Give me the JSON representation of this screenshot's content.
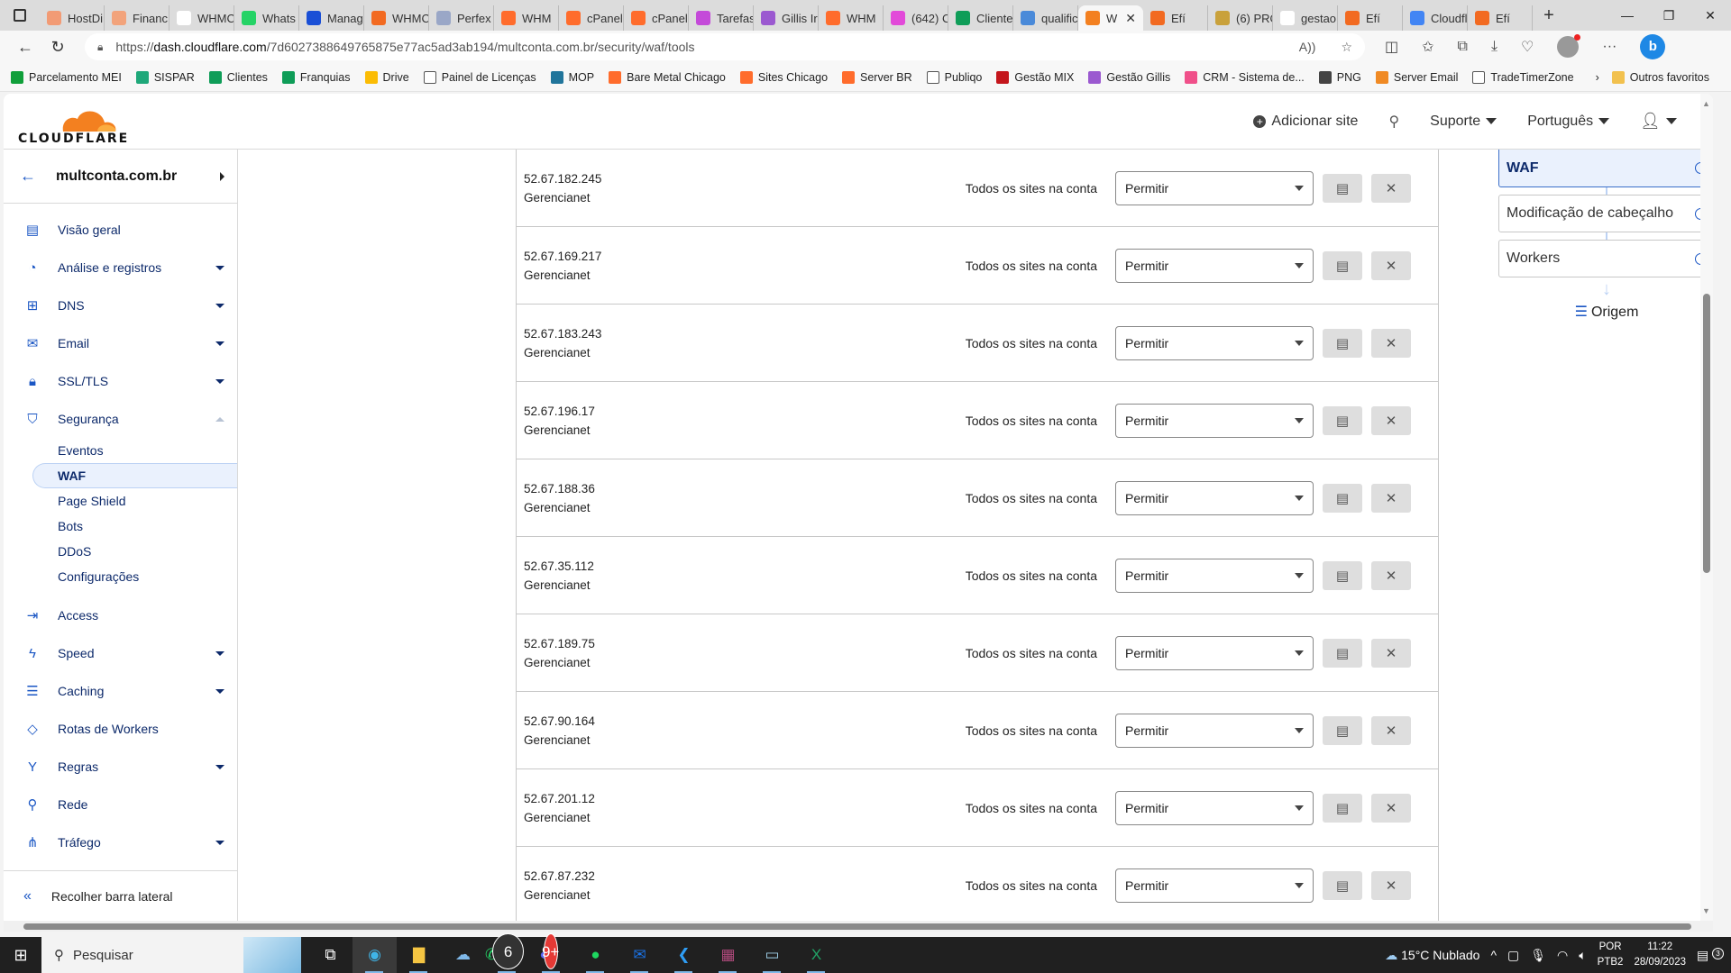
{
  "browser": {
    "tabs": [
      {
        "label": "HostDi",
        "color": "#f29b75"
      },
      {
        "label": "Financ",
        "color": "#f2a37b"
      },
      {
        "label": "WHMC",
        "color": "#ffffff"
      },
      {
        "label": "Whats",
        "color": "#25d366"
      },
      {
        "label": "Manag",
        "color": "#1a4fd6"
      },
      {
        "label": "WHMC",
        "color": "#f26a21"
      },
      {
        "label": "Perfex",
        "color": "#9aa7c7"
      },
      {
        "label": "WHM",
        "color": "#ff6c2c"
      },
      {
        "label": "cPanel",
        "color": "#ff6c2c"
      },
      {
        "label": "cPanel",
        "color": "#ff6c2c"
      },
      {
        "label": "Tarefas",
        "color": "#c44ad9"
      },
      {
        "label": "Gillis Ir",
        "color": "#9b59d0"
      },
      {
        "label": "WHM",
        "color": "#ff6c2c"
      },
      {
        "label": "(642) C",
        "color": "#e24ad9"
      },
      {
        "label": "Cliente",
        "color": "#0f9d58"
      },
      {
        "label": "qualific",
        "color": "#4a8ad9"
      },
      {
        "label": "W",
        "color": "#f38020",
        "active": true
      },
      {
        "label": "Efí",
        "color": "#f26a21"
      },
      {
        "label": "(6) PRO",
        "color": "#c9a13b"
      },
      {
        "label": "gestao",
        "color": "#ffffff"
      },
      {
        "label": "Efí",
        "color": "#f26a21"
      },
      {
        "label": "Cloudfl",
        "color": "#4285f4"
      },
      {
        "label": "Efí",
        "color": "#f26a21"
      }
    ],
    "url_prefix": "https://",
    "url_domain": "dash.cloudflare.com",
    "url_path": "/7d6027388649765875e77ac5ad3ab194/multconta.com.br/security/waf/tools",
    "bookmarks": [
      {
        "label": "Parcelamento MEI",
        "color": "#109f3a"
      },
      {
        "label": "SISPAR",
        "color": "#1fa87a"
      },
      {
        "label": "Clientes",
        "color": "#0f9d58"
      },
      {
        "label": "Franquias",
        "color": "#0f9d58"
      },
      {
        "label": "Drive",
        "color": "#fbbc04"
      },
      {
        "label": "Painel de Licenças",
        "color": "#ffffff"
      },
      {
        "label": "MOP",
        "color": "#21759b"
      },
      {
        "label": "Bare Metal Chicago",
        "color": "#ff6c2c"
      },
      {
        "label": "Sites Chicago",
        "color": "#ff6c2c"
      },
      {
        "label": "Server BR",
        "color": "#ff6c2c"
      },
      {
        "label": "Publiqo",
        "color": "#ffffff"
      },
      {
        "label": "Gestão MIX",
        "color": "#c4161c"
      },
      {
        "label": "Gestão Gillis",
        "color": "#9b59d0"
      },
      {
        "label": "CRM - Sistema de...",
        "color": "#f0508a"
      },
      {
        "label": "PNG",
        "color": "#444444"
      },
      {
        "label": "Server Email",
        "color": "#f08a24"
      },
      {
        "label": "TradeTimerZone",
        "color": "#ffffff"
      }
    ],
    "other_bookmarks": "Outros favoritos"
  },
  "header": {
    "brand": "CLOUDFLARE",
    "add_site": "Adicionar site",
    "support": "Suporte",
    "language": "Português"
  },
  "sidebar": {
    "zone": "multconta.com.br",
    "items": [
      {
        "label": "Visão geral",
        "icon": "clipboard",
        "dropdown": false
      },
      {
        "label": "Análise e registros",
        "icon": "pie",
        "dropdown": true
      },
      {
        "label": "DNS",
        "icon": "network",
        "dropdown": true
      },
      {
        "label": "Email",
        "icon": "email",
        "dropdown": true
      },
      {
        "label": "SSL/TLS",
        "icon": "lock",
        "dropdown": true
      },
      {
        "label": "Segurança",
        "icon": "shield",
        "dropdown": "open"
      }
    ],
    "security_sub": [
      "Eventos",
      "WAF",
      "Page Shield",
      "Bots",
      "DDoS",
      "Configurações"
    ],
    "active_sub": "WAF",
    "items2": [
      {
        "label": "Access",
        "icon": "access",
        "dropdown": false
      },
      {
        "label": "Speed",
        "icon": "bolt",
        "dropdown": true
      },
      {
        "label": "Caching",
        "icon": "server",
        "dropdown": true
      },
      {
        "label": "Rotas de Workers",
        "icon": "workers",
        "dropdown": false
      },
      {
        "label": "Regras",
        "icon": "rules",
        "dropdown": true
      },
      {
        "label": "Rede",
        "icon": "pin",
        "dropdown": false
      },
      {
        "label": "Tráfego",
        "icon": "traffic",
        "dropdown": true
      }
    ],
    "collapse_label": "Recolher barra lateral"
  },
  "rules": [
    {
      "ip": "52.67.182.245",
      "note": "Gerencianet",
      "scope": "Todos os sites na conta",
      "action": "Permitir"
    },
    {
      "ip": "52.67.169.217",
      "note": "Gerencianet",
      "scope": "Todos os sites na conta",
      "action": "Permitir"
    },
    {
      "ip": "52.67.183.243",
      "note": "Gerencianet",
      "scope": "Todos os sites na conta",
      "action": "Permitir"
    },
    {
      "ip": "52.67.196.17",
      "note": "Gerencianet",
      "scope": "Todos os sites na conta",
      "action": "Permitir"
    },
    {
      "ip": "52.67.188.36",
      "note": "Gerencianet",
      "scope": "Todos os sites na conta",
      "action": "Permitir"
    },
    {
      "ip": "52.67.35.112",
      "note": "Gerencianet",
      "scope": "Todos os sites na conta",
      "action": "Permitir"
    },
    {
      "ip": "52.67.189.75",
      "note": "Gerencianet",
      "scope": "Todos os sites na conta",
      "action": "Permitir"
    },
    {
      "ip": "52.67.90.164",
      "note": "Gerencianet",
      "scope": "Todos os sites na conta",
      "action": "Permitir"
    },
    {
      "ip": "52.67.201.12",
      "note": "Gerencianet",
      "scope": "Todos os sites na conta",
      "action": "Permitir"
    },
    {
      "ip": "52.67.87.232",
      "note": "Gerencianet",
      "scope": "Todos os sites na conta",
      "action": "Permitir"
    }
  ],
  "flow": {
    "steps": [
      {
        "label": "WAF",
        "active": true
      },
      {
        "label": "Modificação de cabeçalho",
        "active": false
      },
      {
        "label": "Workers",
        "active": false
      }
    ],
    "origin": "Origem"
  },
  "taskbar": {
    "search": "Pesquisar",
    "whatsapp_badge": "6",
    "discord_badge": "9+",
    "weather": "15°C  Nublado",
    "lang_top": "POR",
    "lang_bottom": "PTB2",
    "time": "11:22",
    "date": "28/09/2023",
    "notifications": "3"
  },
  "colors": {
    "accent": "#1a56c4",
    "brand_orange": "#f38020",
    "nav_text": "#0d2a6b"
  }
}
